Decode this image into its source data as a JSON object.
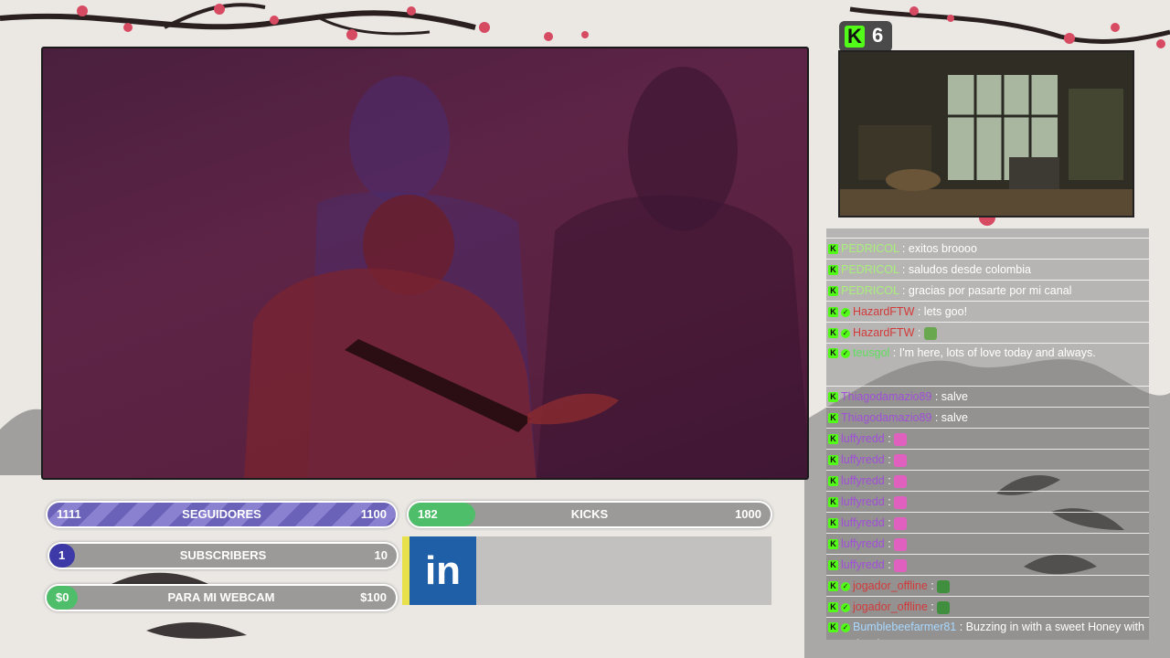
{
  "overlay": {
    "kick_viewer_badge": {
      "icon": "kick-icon",
      "count": "6"
    },
    "goals": {
      "followers": {
        "current": "1111",
        "label": "SEGUIDORES",
        "target": "1100",
        "progress": 1.0,
        "color": "#6a61b8"
      },
      "subscribers": {
        "current": "1",
        "label": "SUBSCRIBERS",
        "target": "10",
        "progress": 0.1,
        "color": "#3d3aa8"
      },
      "webcam": {
        "current": "$0",
        "label": "PARA MI WEBCAM",
        "target": "$100",
        "progress": 0.0,
        "color": "#4fbe6a"
      },
      "kicks": {
        "current": "182",
        "label": "KICKS",
        "target": "1000",
        "progress": 0.182,
        "color": "#4fbe6a"
      }
    },
    "social": {
      "icon": "linkedin-icon",
      "text": "in",
      "color": "#1f5fa8"
    }
  },
  "chat": {
    "messages": [
      {
        "user": "PEDRICOL",
        "user_color": "#a8f07a",
        "verified": false,
        "text": ": exitos broooo"
      },
      {
        "user": "PEDRICOL",
        "user_color": "#a8f07a",
        "verified": false,
        "text": ": saludos desde colombia"
      },
      {
        "user": "PEDRICOL",
        "user_color": "#a8f07a",
        "verified": false,
        "text": ": gracias por pasarte por mi canal"
      },
      {
        "user": "HazardFTW",
        "user_color": "#d23a3a",
        "verified": true,
        "text": ": lets goo!"
      },
      {
        "user": "HazardFTW",
        "user_color": "#d23a3a",
        "verified": true,
        "text": ":",
        "emote": "frog-emote"
      },
      {
        "user": "teusgol",
        "user_color": "#5ee05e",
        "verified": true,
        "text": ": I'm here, lots of love today and always."
      },
      {
        "user": "Thiagodamazio89",
        "user_color": "#a04fd6",
        "verified": false,
        "text": ": salve"
      },
      {
        "user": "Thiagodamazio89",
        "user_color": "#a04fd6",
        "verified": false,
        "text": ": salve"
      },
      {
        "user": "luffyredd",
        "user_color": "#a04fd6",
        "verified": false,
        "text": ":",
        "emote": "pink-emote"
      },
      {
        "user": "luffyredd",
        "user_color": "#a04fd6",
        "verified": false,
        "text": ":",
        "emote": "pink-emote"
      },
      {
        "user": "luffyredd",
        "user_color": "#a04fd6",
        "verified": false,
        "text": ":",
        "emote": "pink-emote"
      },
      {
        "user": "luffyredd",
        "user_color": "#a04fd6",
        "verified": false,
        "text": ":",
        "emote": "pink-emote"
      },
      {
        "user": "luffyredd",
        "user_color": "#a04fd6",
        "verified": false,
        "text": ":",
        "emote": "pink-emote"
      },
      {
        "user": "luffyredd",
        "user_color": "#a04fd6",
        "verified": false,
        "text": ":",
        "emote": "pink-emote"
      },
      {
        "user": "luffyredd",
        "user_color": "#a04fd6",
        "verified": false,
        "text": ":",
        "emote": "pink-emote"
      },
      {
        "user": "jogador_offline",
        "user_color": "#d23a3a",
        "verified": true,
        "text": ":",
        "emote": "pepe-emote"
      },
      {
        "user": "jogador_offline",
        "user_color": "#d23a3a",
        "verified": true,
        "text": ":",
        "emote": "pepe-emote"
      },
      {
        "user": "Bumblebeefarmer81",
        "user_color": "#a8d8ff",
        "verified": true,
        "text": ": Buzzing in with a sweet Honey with Hot Biscuits"
      }
    ]
  }
}
